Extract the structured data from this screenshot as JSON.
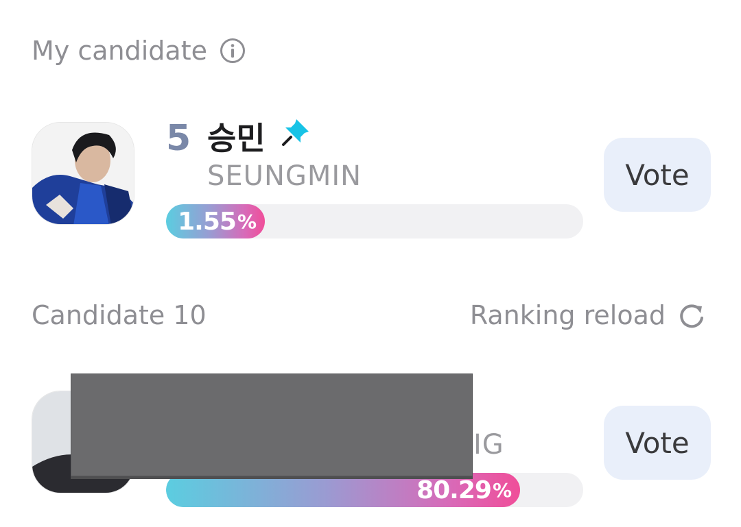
{
  "my_candidate": {
    "title": "My candidate",
    "info_icon": "info-icon",
    "rank": "5",
    "name_ko": "승민",
    "name_en": "SEUNGMIN",
    "pin_icon": "pin-icon",
    "percent_value": "1.55",
    "percent_unit": "%",
    "percent_fraction": 0.0155,
    "vote_label": "Vote"
  },
  "list": {
    "title": "Candidate 10",
    "reload_label": "Ranking reload",
    "reload_icon": "reload-icon",
    "items": [
      {
        "name_en_partial": "IG",
        "percent_value": "80.29",
        "percent_unit": "%",
        "percent_fraction": 0.8029,
        "vote_label": "Vote"
      }
    ]
  },
  "colors": {
    "accent_pin": "#17c3e6",
    "rank": "#7a88a8",
    "vote_bg": "#e9effa",
    "gradient_start": "#5bcde0",
    "gradient_end": "#f04e99"
  }
}
